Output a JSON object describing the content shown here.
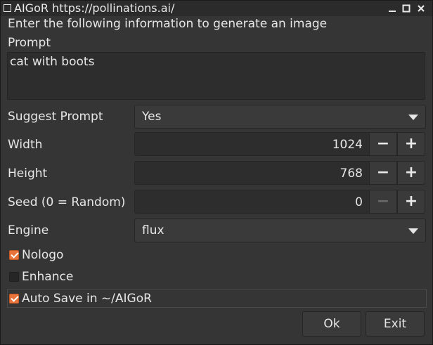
{
  "window": {
    "title": "AIGoR https://pollinations.ai/"
  },
  "header": {
    "instructions": "Enter the following information to generate an image",
    "prompt_label": "Prompt"
  },
  "prompt": {
    "value": "cat with boots"
  },
  "suggest_prompt": {
    "label": "Suggest Prompt",
    "value": "Yes"
  },
  "width": {
    "label": "Width",
    "value": "1024"
  },
  "height": {
    "label": "Height",
    "value": "768"
  },
  "seed": {
    "label": "Seed (0 = Random)",
    "value": "0"
  },
  "engine": {
    "label": "Engine",
    "value": "flux"
  },
  "checkboxes": {
    "nologo": {
      "label": "Nologo",
      "checked": true
    },
    "enhance": {
      "label": "Enhance",
      "checked": false
    },
    "autosave": {
      "label": "Auto Save in ~/AIGoR",
      "checked": true
    }
  },
  "buttons": {
    "ok": "Ok",
    "exit": "Exit"
  },
  "colors": {
    "accent": "#e8743b",
    "background": "#353535"
  },
  "icons": {
    "minimize": "minimize-icon",
    "maximize": "maximize-icon",
    "close": "close-icon"
  }
}
